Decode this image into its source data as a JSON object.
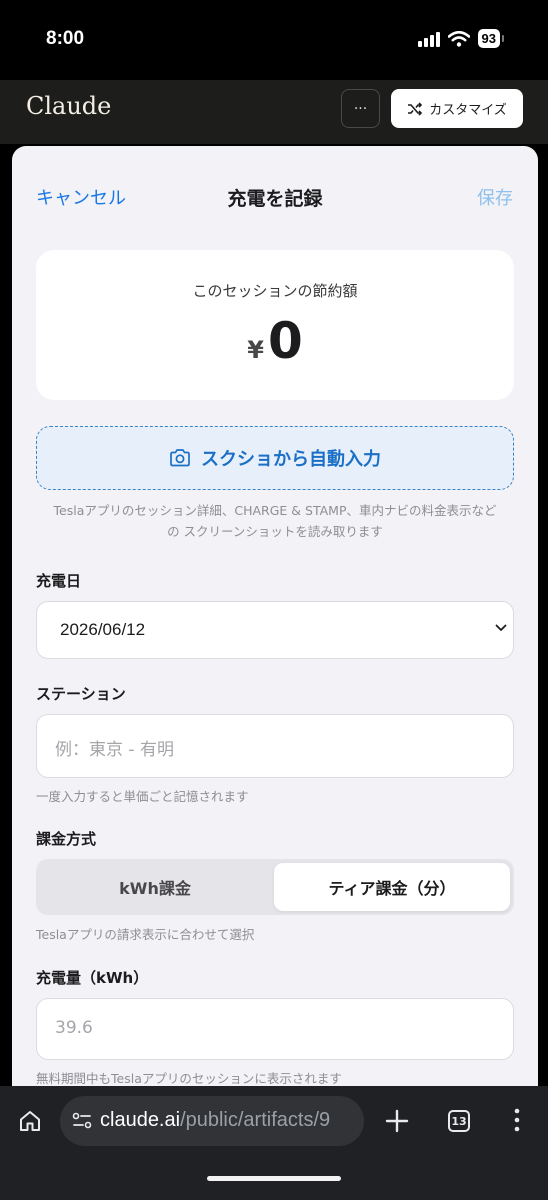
{
  "status_bar": {
    "time": "8:00",
    "battery": "93"
  },
  "app_header": {
    "logo": "Claude",
    "more_label": "···",
    "customize_label": "カスタマイズ"
  },
  "nav": {
    "cancel": "キャンセル",
    "title": "充電を記録",
    "save": "保存"
  },
  "savings": {
    "label": "このセッションの節約額",
    "currency": "¥",
    "amount": "0"
  },
  "scan": {
    "label": "スクショから自動入力",
    "hint_line1": "Teslaアプリのセッション詳細、CHARGE & STAMP、車内ナビの料金表示など",
    "hint_line2": "の スクリーンショットを読み取ります"
  },
  "charge_date": {
    "label": "充電日",
    "value": "2026/06/12"
  },
  "station": {
    "label": "ステーション",
    "placeholder": "例：東京 - 有明",
    "helper": "一度入力すると単価ごと記憶されます"
  },
  "billing": {
    "label": "課金方式",
    "options": [
      "kWh課金",
      "ティア課金（分）"
    ],
    "selected": "ティア課金（分）",
    "helper": "Teslaアプリの請求表示に合わせて選択"
  },
  "energy": {
    "label": "充電量（kWh）",
    "placeholder": "39.6",
    "helper": "無料期間中もTeslaアプリのセッションに表示されます"
  },
  "browser": {
    "url_host": "claude.ai",
    "url_path": "/public/artifacts/9",
    "tab_count": "13"
  },
  "colors": {
    "accent": "#1877e5",
    "save_disabled": "#8fc0ec",
    "scan_border": "#3b82c4"
  }
}
